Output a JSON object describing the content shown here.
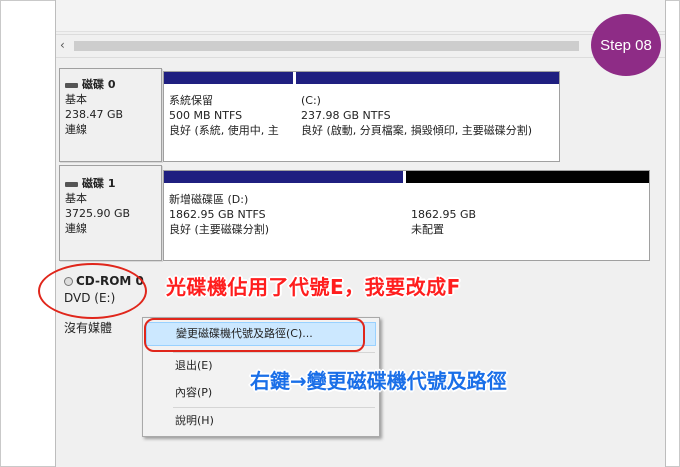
{
  "step_badge": "Step 08",
  "colors": {
    "primary_partition": "#1f1f80",
    "unallocated": "#000000",
    "annotation_red": "#ff1e1e",
    "annotation_blue": "#1a6fe8",
    "badge": "#8e2c86",
    "menu_highlight": "#cce8ff"
  },
  "scrollbar": {
    "left_arrow": "‹"
  },
  "disks": [
    {
      "icon": "disk-icon",
      "name": "磁碟 0",
      "type": "基本",
      "size": "238.47 GB",
      "status": "連線",
      "partitions": [
        {
          "name": "系統保留",
          "size_fs": "500 MB NTFS",
          "status": "良好 (系統, 使用中, 主"
        },
        {
          "name": "(C:)",
          "size_fs": "237.98 GB NTFS",
          "status": "良好 (啟動, 分頁檔案, 損毀傾印, 主要磁碟分割)"
        }
      ]
    },
    {
      "icon": "disk-icon",
      "name": "磁碟 1",
      "type": "基本",
      "size": "3725.90 GB",
      "status": "連線",
      "partitions": [
        {
          "name": "新增磁碟區 (D:)",
          "size_fs": "1862.95 GB NTFS",
          "status": "良好 (主要磁碟分割)"
        },
        {
          "name": "",
          "size_fs": "1862.95 GB",
          "status": "未配置"
        }
      ]
    },
    {
      "icon": "cd-icon",
      "name": "CD-ROM 0",
      "type": "DVD (E:)",
      "status": "沒有媒體"
    }
  ],
  "context_menu": {
    "items": [
      {
        "label": "變更磁碟機代號及路徑(C)..."
      },
      {
        "label": "退出(E)"
      },
      {
        "label": "內容(P)"
      },
      {
        "label": "說明(H)"
      }
    ]
  },
  "annotations": {
    "red_text": "光碟機佔用了代號E，我要改成F",
    "blue_text": "右鍵→變更磁碟機代號及路徑"
  }
}
